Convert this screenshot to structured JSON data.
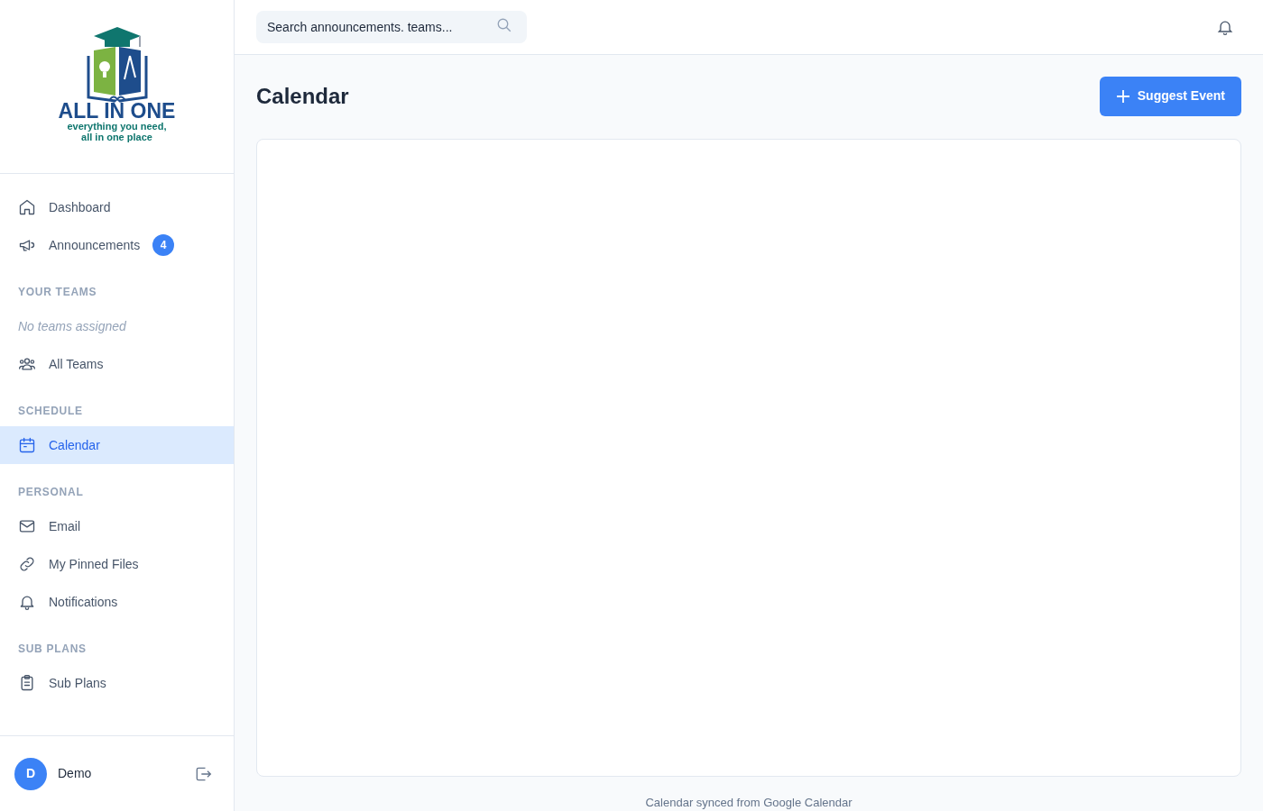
{
  "logo": {
    "title": "ALL IN ONE",
    "tagline_1": "everything you need,",
    "tagline_2": "all in one place"
  },
  "sidebar": {
    "sections": [
      {
        "items": [
          {
            "kind": "link",
            "label": "Dashboard",
            "selected": false
          },
          {
            "kind": "link",
            "label": "Announcements",
            "badge": "4",
            "selected": false
          }
        ]
      },
      {
        "heading": "YOUR TEAMS",
        "items": [
          {
            "kind": "note",
            "label": "No teams assigned"
          },
          {
            "kind": "link",
            "label": "All Teams",
            "selected": false
          }
        ]
      },
      {
        "heading": "SCHEDULE",
        "items": [
          {
            "kind": "link",
            "label": "Calendar",
            "selected": true
          }
        ]
      },
      {
        "heading": "PERSONAL",
        "items": [
          {
            "kind": "link",
            "label": "Email",
            "selected": false
          },
          {
            "kind": "link",
            "label": "My Pinned Files",
            "selected": false
          },
          {
            "kind": "link",
            "label": "Notifications",
            "selected": false
          }
        ]
      },
      {
        "heading": "SUB PLANS",
        "items": [
          {
            "kind": "link",
            "label": "Sub Plans",
            "selected": false
          }
        ]
      }
    ],
    "user": {
      "initial": "D",
      "name": "Demo"
    }
  },
  "search": {
    "placeholder": "Search announcements. teams..."
  },
  "page": {
    "title": "Calendar",
    "action": "Suggest Event",
    "footer": "Calendar synced from Google Calendar"
  }
}
